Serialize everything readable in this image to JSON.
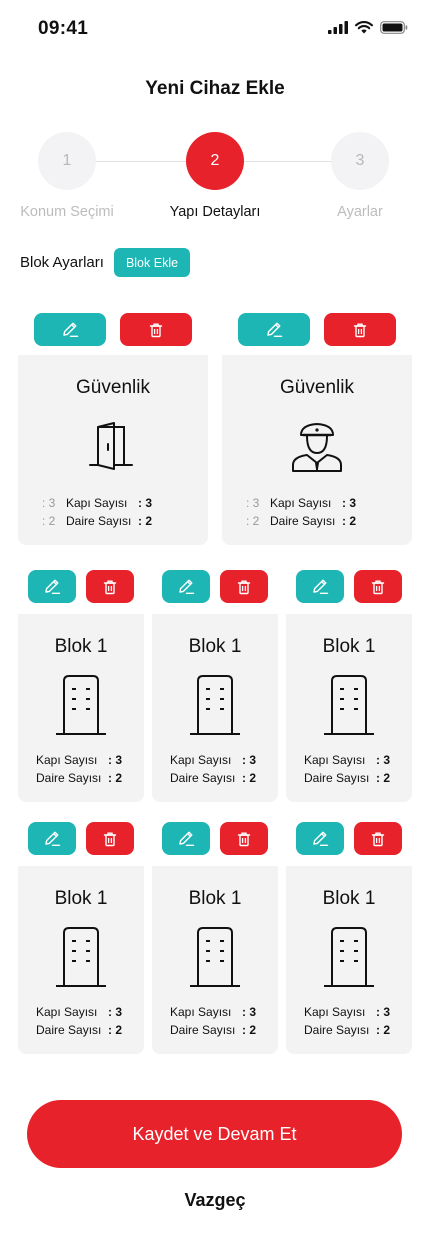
{
  "status_bar": {
    "time": "09:41"
  },
  "title": "Yeni Cihaz Ekle",
  "stepper": {
    "steps": [
      {
        "number": "1",
        "label": "Konum Seçimi"
      },
      {
        "number": "2",
        "label": "Yapı Detayları"
      },
      {
        "number": "3",
        "label": "Ayarlar"
      }
    ],
    "active_step": 2
  },
  "blocks_section": {
    "label": "Blok Ayarları",
    "add_button": "Blok Ekle"
  },
  "stats_labels": {
    "door": "Kapı Sayısı",
    "flat": "Daire Sayısı"
  },
  "security_cards": [
    {
      "title": "Güvenlik",
      "icon": "door-icon",
      "door_pre": ": 3",
      "door_value": ": 3",
      "flat_pre": ": 2",
      "flat_value": ": 2"
    },
    {
      "title": "Güvenlik",
      "icon": "security-guard-icon",
      "door_pre": ": 3",
      "door_value": ": 3",
      "flat_pre": ": 2",
      "flat_value": ": 2"
    }
  ],
  "block_cards": [
    {
      "title": "Blok 1",
      "icon": "building-icon",
      "door_value": ": 3",
      "flat_value": ": 2"
    },
    {
      "title": "Blok 1",
      "icon": "building-icon",
      "door_value": ": 3",
      "flat_value": ": 2"
    },
    {
      "title": "Blok 1",
      "icon": "building-icon",
      "door_value": ": 3",
      "flat_value": ": 2"
    },
    {
      "title": "Blok 1",
      "icon": "building-icon",
      "door_value": ": 3",
      "flat_value": ": 2"
    },
    {
      "title": "Blok 1",
      "icon": "building-icon",
      "door_value": ": 3",
      "flat_value": ": 2"
    },
    {
      "title": "Blok 1",
      "icon": "building-icon",
      "door_value": ": 3",
      "flat_value": ": 2"
    }
  ],
  "actions": {
    "primary": "Kaydet ve Devam Et",
    "cancel": "Vazgeç"
  },
  "colors": {
    "brand_red": "#e8222b",
    "accent_teal": "#1eb5b5",
    "card_bg": "#f3f3f3"
  }
}
